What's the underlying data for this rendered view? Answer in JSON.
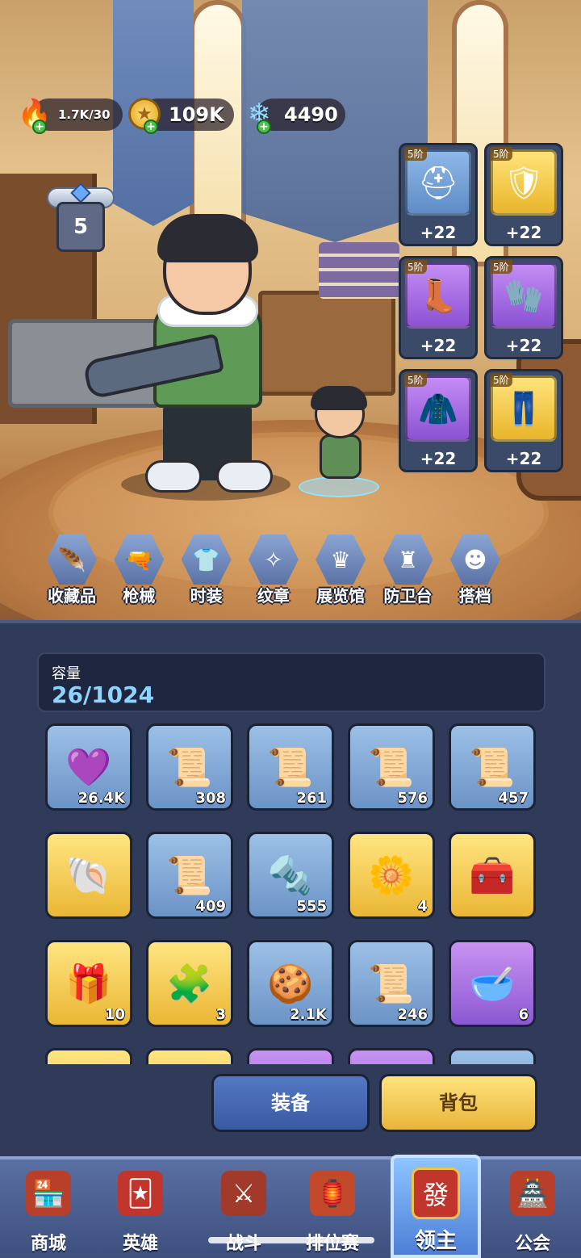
{
  "resources": {
    "stamina": "1.7K/30",
    "gold": "109K",
    "crystal": "4490"
  },
  "lord_level": "5",
  "equipment": [
    {
      "tier": "5阶",
      "level": "+22",
      "color": "blue",
      "icon": "helmet-icon"
    },
    {
      "tier": "5阶",
      "level": "+22",
      "color": "gold",
      "icon": "armor-icon"
    },
    {
      "tier": "5阶",
      "level": "+22",
      "color": "purple",
      "icon": "boots-icon"
    },
    {
      "tier": "5阶",
      "level": "+22",
      "color": "purple",
      "icon": "gauntlet-icon"
    },
    {
      "tier": "5阶",
      "level": "+22",
      "color": "purple",
      "icon": "cloak-icon"
    },
    {
      "tier": "5阶",
      "level": "+22",
      "color": "gold",
      "icon": "leg-armor-icon"
    }
  ],
  "categories": [
    "收藏品",
    "枪械",
    "时装",
    "纹章",
    "展览馆",
    "防卫台",
    "搭档"
  ],
  "capacity": {
    "label": "容量",
    "value": "26/1024"
  },
  "inventory": [
    {
      "color": "blue",
      "icon": "purple-slime-icon",
      "count": "26.4K"
    },
    {
      "color": "blue",
      "icon": "scroll-pants-icon",
      "count": "308"
    },
    {
      "color": "blue",
      "icon": "scroll-glove-icon",
      "count": "261"
    },
    {
      "color": "blue",
      "icon": "scroll-armor-icon",
      "count": "576"
    },
    {
      "color": "blue",
      "icon": "scroll-cloak-icon",
      "count": "457"
    },
    {
      "color": "gold",
      "icon": "pearl-shell-icon",
      "count": ""
    },
    {
      "color": "blue",
      "icon": "scroll-boots-icon",
      "count": "409"
    },
    {
      "color": "blue",
      "icon": "bolt-nut-icon",
      "count": "555"
    },
    {
      "color": "gold",
      "icon": "flower-icon",
      "count": "4"
    },
    {
      "color": "gold",
      "icon": "iron-chest-icon",
      "count": ""
    },
    {
      "color": "gold",
      "icon": "golden-chest-icon",
      "count": "10"
    },
    {
      "color": "gold",
      "icon": "puzzle-piece-icon",
      "count": "3"
    },
    {
      "color": "blue",
      "icon": "cat-cookie-icon",
      "count": "2.1K"
    },
    {
      "color": "blue",
      "icon": "scroll-helmet-icon",
      "count": "246"
    },
    {
      "color": "purple",
      "icon": "potion-bowl-icon",
      "count": "6"
    },
    {
      "color": "gold",
      "icon": "item-icon",
      "count": ""
    },
    {
      "color": "gold",
      "icon": "item-icon",
      "count": ""
    },
    {
      "color": "purple",
      "icon": "item-icon",
      "count": ""
    },
    {
      "color": "purple",
      "icon": "item-icon",
      "count": ""
    },
    {
      "color": "blue",
      "icon": "item-icon",
      "count": ""
    }
  ],
  "actions": {
    "equip": "装备",
    "bag": "背包"
  },
  "nav": [
    "商城",
    "英雄",
    "战斗",
    "排位赛",
    "领主",
    "公会"
  ],
  "nav_active": "领主"
}
